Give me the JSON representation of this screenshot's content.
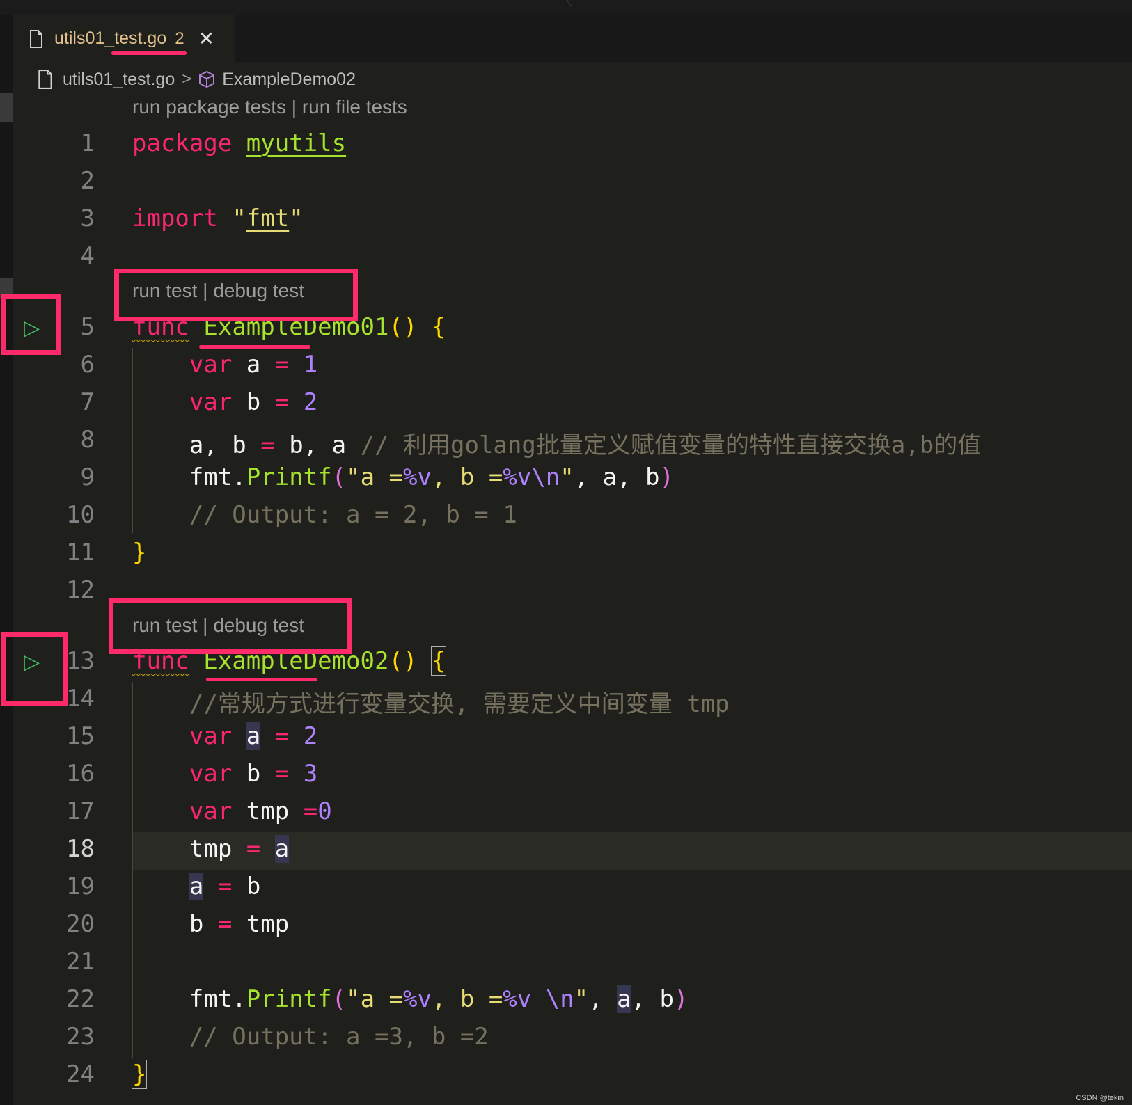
{
  "tab": {
    "title": "utils01_test.go",
    "problem_count": "2",
    "close_label": "✕"
  },
  "breadcrumb": {
    "file": "utils01_test.go",
    "separator": ">",
    "symbol": "ExampleDemo02"
  },
  "codelens": {
    "package": "run package tests | run file tests",
    "demo01": "run test | debug test",
    "demo02": "run test | debug test"
  },
  "line_numbers": [
    "1",
    "2",
    "3",
    "4",
    "5",
    "6",
    "7",
    "8",
    "9",
    "10",
    "11",
    "12",
    "13",
    "14",
    "15",
    "16",
    "17",
    "18",
    "19",
    "20",
    "21",
    "22",
    "23",
    "24"
  ],
  "code": {
    "l1_kw": "package",
    "l1_name": "myutils",
    "l3_kw": "import",
    "l3_q1": "\"",
    "l3_pkg": "fmt",
    "l3_q2": "\"",
    "l5_kw": "func",
    "l5_name": "ExampleDemo01",
    "l5_paren": "()",
    "l5_brace": "{",
    "l6_kw": "var",
    "l6_id": "a",
    "l6_op": "=",
    "l6_num": "1",
    "l7_kw": "var",
    "l7_id": "b",
    "l7_op": "=",
    "l7_num": "2",
    "l8_lhs": "a, b",
    "l8_op": "=",
    "l8_rhs": "b, a",
    "l8_comment": "// 利用golang批量定义赋值变量的特性直接交换a,b的值",
    "l9_pkg": "fmt.",
    "l9_fn": "Printf",
    "l9_open": "(",
    "l9_str1": "\"a =",
    "l9_v1": "%v",
    "l9_str2": ", b =",
    "l9_v2": "%v",
    "l9_esc": "\\n",
    "l9_str3": "\"",
    "l9_args": ", a, b",
    "l9_close": ")",
    "l10_comment": "// Output: a = 2, b = 1",
    "l11_brace": "}",
    "l13_kw": "func",
    "l13_name": "ExampleDemo02",
    "l13_paren": "()",
    "l13_brace": "{",
    "l14_comment": "//常规方式进行变量交换, 需要定义中间变量 tmp",
    "l15_kw": "var",
    "l15_id": "a",
    "l15_op": "=",
    "l15_num": "2",
    "l16_kw": "var",
    "l16_id": "b",
    "l16_op": "=",
    "l16_num": "3",
    "l17_kw": "var",
    "l17_id": "tmp",
    "l17_op": "=",
    "l17_num": "0",
    "l18_id": "tmp",
    "l18_op": "=",
    "l18_rhs": "a",
    "l19_id": "a",
    "l19_op": "=",
    "l19_rhs": "b",
    "l20_id": "b",
    "l20_op": "=",
    "l20_rhs": "tmp",
    "l22_pkg": "fmt.",
    "l22_fn": "Printf",
    "l22_open": "(",
    "l22_str1": "\"a =",
    "l22_v1": "%v",
    "l22_str2": ", b =",
    "l22_v2": "%v",
    "l22_esc": " \\n",
    "l22_str3": "\"",
    "l22_sep": ", ",
    "l22_a": "a",
    "l22_rest": ", b",
    "l22_close": ")",
    "l23_comment": "// Output: a =3, b =2",
    "l24_brace": "}"
  },
  "run_glyph": "▷",
  "watermark": "CSDN @tekin",
  "colors": {
    "keyword": "#f92672",
    "string": "#e6db74",
    "function": "#a6e22e",
    "number": "#ae81ff",
    "comment": "#75715e",
    "annotation": "#ff2a6a",
    "run": "#43c26a"
  }
}
